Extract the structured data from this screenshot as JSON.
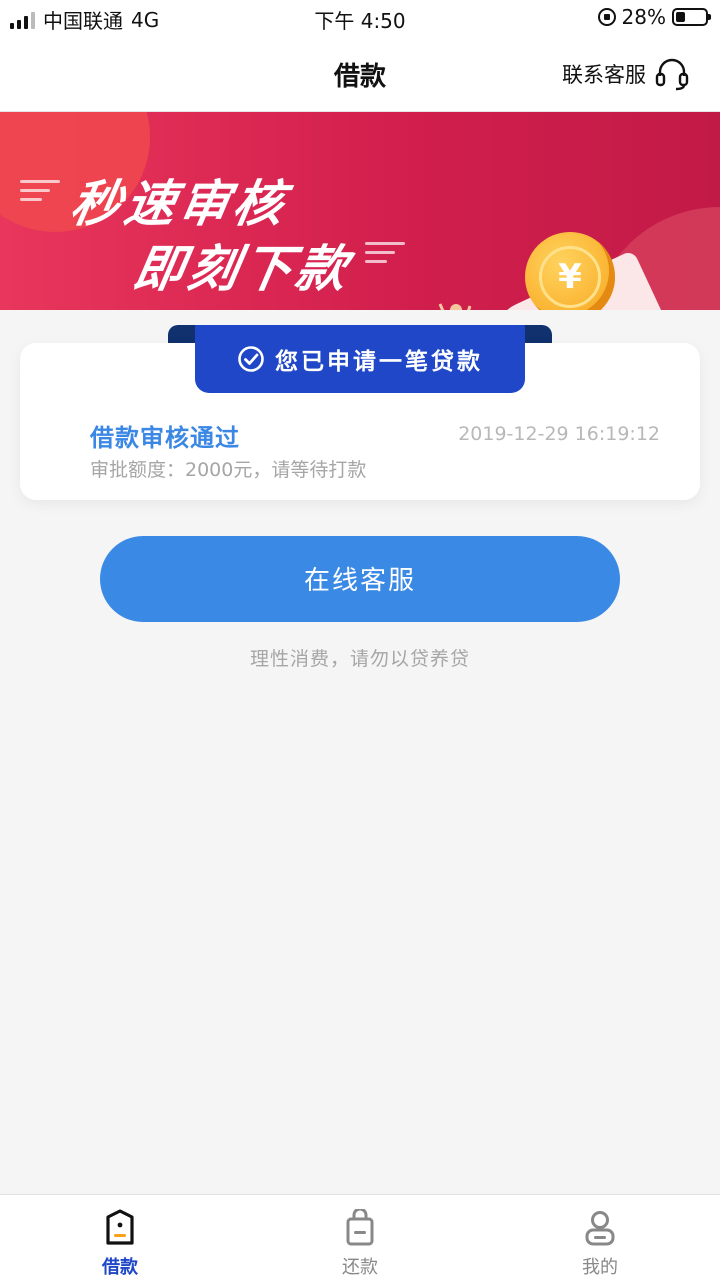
{
  "status_bar": {
    "carrier": "中国联通",
    "network": "4G",
    "time": "下午 4:50",
    "battery": "28%"
  },
  "nav": {
    "title": "借款",
    "contact_label": "联系客服"
  },
  "banner": {
    "line1": "秒速审核",
    "line2": "即刻下款",
    "coin_symbol": "¥"
  },
  "card": {
    "ribbon_text": "您已申请一笔贷款",
    "status_title": "借款审核通过",
    "status_time": "2019-12-29 16:19:12",
    "status_detail": "审批额度：2000元，请等待打款"
  },
  "online_service_button": "在线客服",
  "tip": "理性消费，请勿以贷养贷",
  "tabs": [
    {
      "label": "借款",
      "icon": "borrow-icon",
      "active": true
    },
    {
      "label": "还款",
      "icon": "repay-icon",
      "active": false
    },
    {
      "label": "我的",
      "icon": "profile-icon",
      "active": false
    }
  ],
  "colors": {
    "accent_blue": "#3a8ae5",
    "ribbon_blue": "#1f47c8",
    "banner_red": "#d21f4d"
  }
}
